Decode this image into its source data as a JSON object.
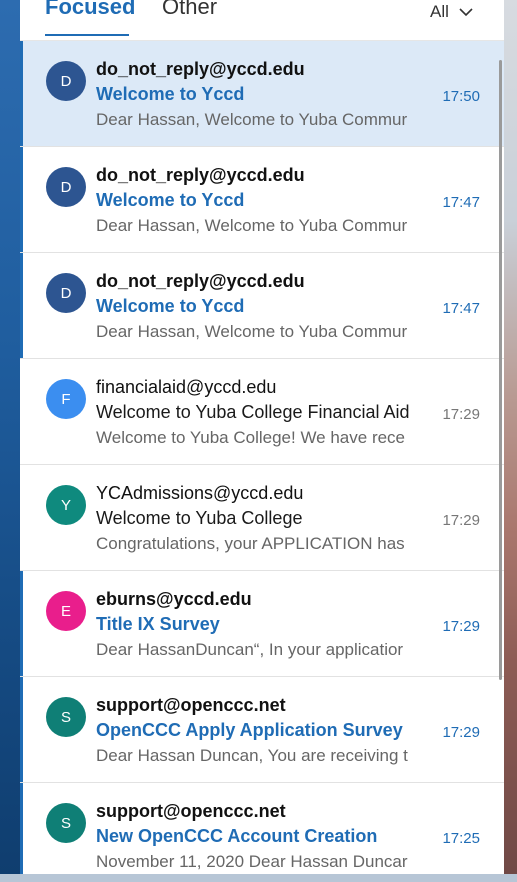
{
  "tabs": {
    "focused": "Focused",
    "other": "Other",
    "filter": "All"
  },
  "colors": {
    "accent": "#1f6cb5",
    "selected_bg": "#dce9f7"
  },
  "messages": [
    {
      "initial": "D",
      "avatar_color": "#2d5591",
      "sender": "do_not_reply@yccd.edu",
      "subject": "Welcome to Yccd",
      "time": "17:50",
      "preview": "Dear Hassan, Welcome to Yuba Commur",
      "unread": true,
      "selected": true
    },
    {
      "initial": "D",
      "avatar_color": "#2d5591",
      "sender": "do_not_reply@yccd.edu",
      "subject": "Welcome to Yccd",
      "time": "17:47",
      "preview": "Dear Hassan, Welcome to Yuba Commur",
      "unread": true,
      "selected": false
    },
    {
      "initial": "D",
      "avatar_color": "#2d5591",
      "sender": "do_not_reply@yccd.edu",
      "subject": "Welcome to Yccd",
      "time": "17:47",
      "preview": "Dear Hassan, Welcome to Yuba Commur",
      "unread": true,
      "selected": false
    },
    {
      "initial": "F",
      "avatar_color": "#3b8ef0",
      "sender": "financialaid@yccd.edu",
      "subject": "Welcome to Yuba College Financial Aid",
      "time": "17:29",
      "preview": "Welcome to Yuba College! We have rece",
      "unread": false,
      "selected": false
    },
    {
      "initial": "Y",
      "avatar_color": "#0f8a7e",
      "sender": "YCAdmissions@yccd.edu",
      "subject": "Welcome to Yuba College",
      "time": "17:29",
      "preview": "Congratulations, your APPLICATION has",
      "unread": false,
      "selected": false
    },
    {
      "initial": "E",
      "avatar_color": "#e91e8c",
      "sender": "eburns@yccd.edu",
      "subject": "Title IX Survey",
      "time": "17:29",
      "preview": "Dear HassanDuncan“, In your applicatior",
      "unread": true,
      "selected": false
    },
    {
      "initial": "S",
      "avatar_color": "#0f7f76",
      "sender": "support@openccc.net",
      "subject": "OpenCCC Apply Application Survey",
      "time": "17:29",
      "preview": "Dear Hassan Duncan, You are receiving t",
      "unread": true,
      "selected": false
    },
    {
      "initial": "S",
      "avatar_color": "#0f7f76",
      "sender": "support@openccc.net",
      "subject": "New OpenCCC Account Creation",
      "time": "17:25",
      "preview": "November 11, 2020 Dear Hassan Duncar",
      "unread": true,
      "selected": false
    }
  ]
}
